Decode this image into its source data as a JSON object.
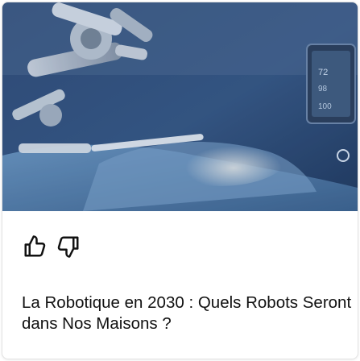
{
  "card": {
    "image": {
      "alt": "Bras robotique chirurgical au-dessus d'un patient dans une salle d'opération",
      "monitor_readouts": [
        "72",
        "98",
        "100"
      ]
    },
    "reactions": {
      "like_icon": "thumbs-up-icon",
      "dislike_icon": "thumbs-down-icon"
    },
    "title": "La Robotique en 2030 : Quels Robots Seront dans Nos Maisons ?"
  }
}
